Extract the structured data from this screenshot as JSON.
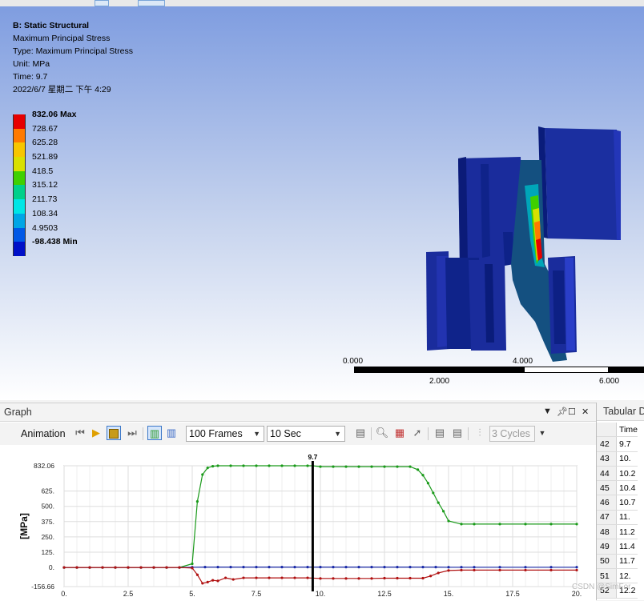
{
  "result_info": {
    "title": "B: Static Structural",
    "result_name": "Maximum Principal Stress",
    "type": "Type: Maximum Principal Stress",
    "unit": "Unit: MPa",
    "time": "Time: 9.7",
    "date": "2022/6/7 星期二 下午 4:29"
  },
  "legend": [
    {
      "label": "832.06 Max",
      "color": "#e60000"
    },
    {
      "label": "728.67",
      "color": "#ff7a00"
    },
    {
      "label": "625.28",
      "color": "#f7c600"
    },
    {
      "label": "521.89",
      "color": "#d9e000"
    },
    {
      "label": "418.5",
      "color": "#3fd000"
    },
    {
      "label": "315.12",
      "color": "#00d08a"
    },
    {
      "label": "211.73",
      "color": "#00e6e6"
    },
    {
      "label": "108.34",
      "color": "#00a6e6"
    },
    {
      "label": "4.9503",
      "color": "#0058e6"
    },
    {
      "label": "-98.438 Min",
      "color": "#0010c8"
    }
  ],
  "scale_bar": {
    "labels": [
      "0.000",
      "2.000",
      "4.000",
      "6.000"
    ]
  },
  "graph_panel": {
    "title": "Graph",
    "header_icons": [
      "pin-icon",
      "maximize-icon",
      "close-icon"
    ],
    "animation_label": "Animation",
    "frames": "100 Frames",
    "duration": "10 Sec",
    "cycles": "3 Cycles"
  },
  "tabular_panel": {
    "title": "Tabular Data",
    "header": "Time",
    "rows": [
      {
        "idx": "42",
        "time": "9.7"
      },
      {
        "idx": "43",
        "time": "10."
      },
      {
        "idx": "44",
        "time": "10.2"
      },
      {
        "idx": "45",
        "time": "10.4"
      },
      {
        "idx": "46",
        "time": "10.7"
      },
      {
        "idx": "47",
        "time": "11."
      },
      {
        "idx": "48",
        "time": "11.2"
      },
      {
        "idx": "49",
        "time": "11.4"
      },
      {
        "idx": "50",
        "time": "11.7"
      },
      {
        "idx": "51",
        "time": "12."
      },
      {
        "idx": "52",
        "time": "12.2"
      }
    ]
  },
  "chart_data": {
    "type": "line",
    "ylabel": "[MPa]",
    "xlim": [
      0,
      20
    ],
    "ylim": [
      -156.66,
      832.06
    ],
    "x_ticks": [
      "0.",
      "2.5",
      "5.",
      "7.5",
      "10.",
      "12.5",
      "15.",
      "17.5",
      "20."
    ],
    "y_ticks": [
      "832.06",
      "625.",
      "500.",
      "375.",
      "250.",
      "125.",
      "0.",
      "-156.66"
    ],
    "y_tick_values": [
      832.06,
      625,
      500,
      375,
      250,
      125,
      0,
      -156.66
    ],
    "current_time": 9.7,
    "current_time_label": "9.7",
    "grid": true,
    "colors": {
      "max": "#1a9a1a",
      "min": "#b01010",
      "avg": "#1a2aa8",
      "grid": "#dddddd"
    },
    "series": [
      {
        "key": "max",
        "x": [
          0,
          0.5,
          1,
          1.5,
          2,
          2.5,
          3,
          3.5,
          4,
          4.5,
          5,
          5.2,
          5.4,
          5.6,
          5.8,
          6,
          6.5,
          7,
          7.5,
          8,
          8.5,
          9,
          9.5,
          9.7,
          10,
          10.5,
          11,
          11.5,
          12,
          12.5,
          13,
          13.5,
          13.8,
          14,
          14.2,
          14.4,
          14.6,
          14.8,
          15,
          15.5,
          16,
          17,
          18,
          19,
          20
        ],
        "y": [
          0,
          0,
          0,
          0,
          0,
          0,
          0,
          0,
          0,
          0,
          30,
          540,
          760,
          815,
          828,
          832,
          832,
          832,
          832,
          832,
          832,
          832,
          832,
          832,
          825,
          825,
          825,
          825,
          825,
          825,
          825,
          825,
          800,
          755,
          690,
          610,
          530,
          460,
          380,
          355,
          355,
          355,
          355,
          355,
          355
        ]
      },
      {
        "key": "avg",
        "x": [
          0,
          0.5,
          1,
          1.5,
          2,
          2.5,
          3,
          3.5,
          4,
          4.5,
          5,
          5.5,
          6,
          6.5,
          7,
          7.5,
          8,
          8.5,
          9,
          9.5,
          10,
          10.5,
          11,
          11.5,
          12,
          12.5,
          13,
          13.5,
          14,
          14.5,
          15,
          15.5,
          16,
          17,
          18,
          19,
          20
        ],
        "y": [
          0,
          0,
          0,
          0,
          0,
          0,
          0,
          0,
          0,
          0,
          2,
          3,
          3,
          3,
          3,
          3,
          3,
          3,
          3,
          3,
          3,
          3,
          3,
          3,
          3,
          3,
          3,
          3,
          3,
          3,
          2,
          2,
          2,
          2,
          2,
          2,
          2
        ]
      },
      {
        "key": "min",
        "x": [
          0,
          0.5,
          1,
          1.5,
          2,
          2.5,
          3,
          3.5,
          4,
          4.5,
          5,
          5.2,
          5.4,
          5.6,
          5.8,
          6,
          6.3,
          6.6,
          7,
          7.5,
          8,
          8.5,
          9,
          9.5,
          10,
          10.5,
          11,
          11.5,
          12,
          12.5,
          13,
          13.5,
          14,
          14.3,
          14.6,
          15,
          15.5,
          16,
          17,
          18,
          19,
          20
        ],
        "y": [
          0,
          0,
          0,
          0,
          0,
          0,
          0,
          0,
          0,
          0,
          -5,
          -60,
          -130,
          -120,
          -105,
          -110,
          -85,
          -98,
          -85,
          -85,
          -85,
          -85,
          -85,
          -85,
          -90,
          -90,
          -90,
          -90,
          -90,
          -88,
          -88,
          -88,
          -88,
          -70,
          -45,
          -25,
          -22,
          -22,
          -22,
          -22,
          -22,
          -22
        ]
      }
    ]
  },
  "watermark": "CSDN @SimFor"
}
